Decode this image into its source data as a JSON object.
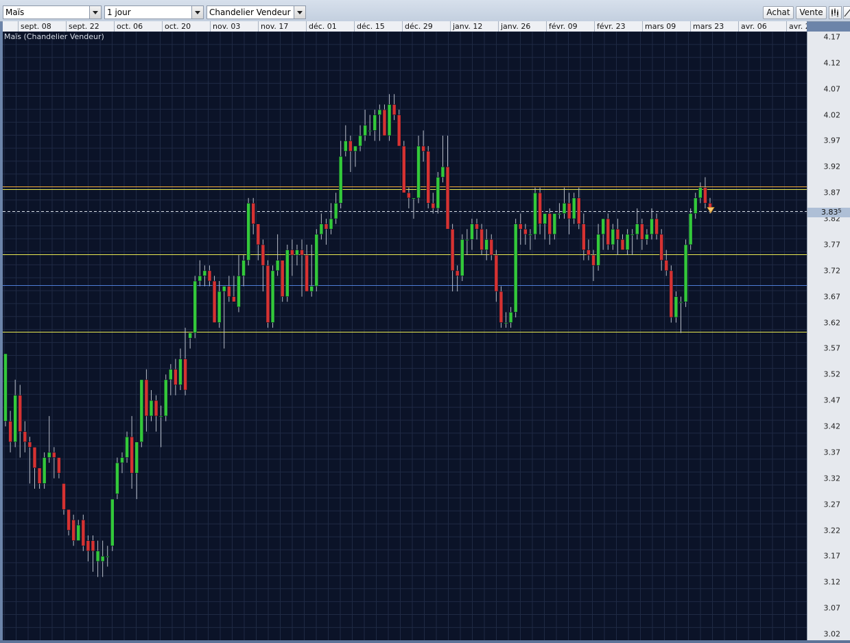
{
  "toolbar": {
    "instrument": "Maïs",
    "timeframe": "1 jour",
    "indicator": "Chandelier Vendeur",
    "buy_label": "Achat",
    "sell_label": "Vente",
    "icons": [
      "candles-icon",
      "draw-line-icon"
    ]
  },
  "colors": {
    "background": "#0b1328",
    "grid": "#1f2a44",
    "up": "#33c93a",
    "down": "#d63232",
    "orange_line": "#f0a838",
    "yellow_line": "#ecec52",
    "blue_line": "#4f7fd8",
    "price_line": "#dfe5ee"
  },
  "chart_data": {
    "type": "candlestick",
    "title": "Maïs (Chandelier Vendeur)",
    "x_labels": [
      "sept. 08",
      "sept. 22",
      "oct. 06",
      "oct. 20",
      "nov. 03",
      "nov. 17",
      "déc. 01",
      "déc. 15",
      "déc. 29",
      "janv. 12",
      "janv. 26",
      "févr. 09",
      "févr. 23",
      "mars 09",
      "mars 23",
      "avr. 06",
      "avr. 2"
    ],
    "ylim": [
      3.02,
      4.17
    ],
    "y_ticks": [
      4.17,
      4.12,
      4.07,
      4.02,
      3.97,
      3.92,
      3.87,
      3.82,
      3.77,
      3.72,
      3.67,
      3.62,
      3.57,
      3.52,
      3.47,
      3.42,
      3.37,
      3.32,
      3.27,
      3.22,
      3.17,
      3.12,
      3.07,
      3.02
    ],
    "current_price": "3.83",
    "current_price_suffix": "5",
    "current_price_value": 3.835,
    "horizontal_lines": [
      {
        "price": 3.882,
        "color": "#f0a838"
      },
      {
        "price": 3.877,
        "color": "#ecec52"
      },
      {
        "price": 3.752,
        "color": "#ecec52"
      },
      {
        "price": 3.692,
        "color": "#4f7fd8"
      },
      {
        "price": 3.602,
        "color": "#ecec52"
      }
    ],
    "candles": [
      {
        "o": 3.43,
        "h": 3.56,
        "l": 3.42,
        "c": 3.56
      },
      {
        "o": 3.43,
        "h": 3.45,
        "l": 3.37,
        "c": 3.39
      },
      {
        "o": 3.39,
        "h": 3.51,
        "l": 3.38,
        "c": 3.48
      },
      {
        "o": 3.48,
        "h": 3.5,
        "l": 3.36,
        "c": 3.41
      },
      {
        "o": 3.41,
        "h": 3.43,
        "l": 3.37,
        "c": 3.39
      },
      {
        "o": 3.39,
        "h": 3.4,
        "l": 3.31,
        "c": 3.38
      },
      {
        "o": 3.38,
        "h": 3.38,
        "l": 3.3,
        "c": 3.34
      },
      {
        "o": 3.34,
        "h": 3.33,
        "l": 3.3,
        "c": 3.31
      },
      {
        "o": 3.31,
        "h": 3.37,
        "l": 3.3,
        "c": 3.36
      },
      {
        "o": 3.36,
        "h": 3.44,
        "l": 3.35,
        "c": 3.37
      },
      {
        "o": 3.37,
        "h": 3.38,
        "l": 3.32,
        "c": 3.36
      },
      {
        "o": 3.36,
        "h": 3.36,
        "l": 3.32,
        "c": 3.33
      },
      {
        "o": 3.31,
        "h": 3.31,
        "l": 3.25,
        "c": 3.26
      },
      {
        "o": 3.26,
        "h": 3.26,
        "l": 3.21,
        "c": 3.22
      },
      {
        "o": 3.24,
        "h": 3.25,
        "l": 3.19,
        "c": 3.2
      },
      {
        "o": 3.2,
        "h": 3.24,
        "l": 3.2,
        "c": 3.23
      },
      {
        "o": 3.24,
        "h": 3.25,
        "l": 3.18,
        "c": 3.19
      },
      {
        "o": 3.2,
        "h": 3.21,
        "l": 3.16,
        "c": 3.18
      },
      {
        "o": 3.2,
        "h": 3.21,
        "l": 3.14,
        "c": 3.18
      },
      {
        "o": 3.16,
        "h": 3.2,
        "l": 3.13,
        "c": 3.18
      },
      {
        "o": 3.16,
        "h": 3.2,
        "l": 3.13,
        "c": 3.17
      },
      {
        "o": 3.17,
        "h": 3.19,
        "l": 3.15,
        "c": 3.17
      },
      {
        "o": 3.19,
        "h": 3.28,
        "l": 3.18,
        "c": 3.28
      },
      {
        "o": 3.29,
        "h": 3.36,
        "l": 3.28,
        "c": 3.35
      },
      {
        "o": 3.35,
        "h": 3.37,
        "l": 3.33,
        "c": 3.36
      },
      {
        "o": 3.36,
        "h": 3.41,
        "l": 3.35,
        "c": 3.4
      },
      {
        "o": 3.4,
        "h": 3.44,
        "l": 3.3,
        "c": 3.33
      },
      {
        "o": 3.33,
        "h": 3.39,
        "l": 3.28,
        "c": 3.39
      },
      {
        "o": 3.39,
        "h": 3.51,
        "l": 3.38,
        "c": 3.51
      },
      {
        "o": 3.51,
        "h": 3.53,
        "l": 3.41,
        "c": 3.44
      },
      {
        "o": 3.44,
        "h": 3.49,
        "l": 3.43,
        "c": 3.47
      },
      {
        "o": 3.47,
        "h": 3.48,
        "l": 3.41,
        "c": 3.44
      },
      {
        "o": 3.44,
        "h": 3.46,
        "l": 3.38,
        "c": 3.44
      },
      {
        "o": 3.44,
        "h": 3.52,
        "l": 3.43,
        "c": 3.51
      },
      {
        "o": 3.51,
        "h": 3.54,
        "l": 3.48,
        "c": 3.53
      },
      {
        "o": 3.53,
        "h": 3.55,
        "l": 3.48,
        "c": 3.5
      },
      {
        "o": 3.5,
        "h": 3.57,
        "l": 3.49,
        "c": 3.55
      },
      {
        "o": 3.55,
        "h": 3.61,
        "l": 3.48,
        "c": 3.49
      },
      {
        "o": 3.59,
        "h": 3.6,
        "l": 3.57,
        "c": 3.6
      },
      {
        "o": 3.6,
        "h": 3.71,
        "l": 3.59,
        "c": 3.7
      },
      {
        "o": 3.7,
        "h": 3.74,
        "l": 3.69,
        "c": 3.71
      },
      {
        "o": 3.71,
        "h": 3.73,
        "l": 3.69,
        "c": 3.72
      },
      {
        "o": 3.72,
        "h": 3.73,
        "l": 3.69,
        "c": 3.7
      },
      {
        "o": 3.7,
        "h": 3.71,
        "l": 3.62,
        "c": 3.62
      },
      {
        "o": 3.62,
        "h": 3.7,
        "l": 3.61,
        "c": 3.68
      },
      {
        "o": 3.68,
        "h": 3.69,
        "l": 3.57,
        "c": 3.69
      },
      {
        "o": 3.69,
        "h": 3.71,
        "l": 3.66,
        "c": 3.67
      },
      {
        "o": 3.67,
        "h": 3.71,
        "l": 3.66,
        "c": 3.66
      },
      {
        "o": 3.65,
        "h": 3.75,
        "l": 3.64,
        "c": 3.71
      },
      {
        "o": 3.71,
        "h": 3.75,
        "l": 3.69,
        "c": 3.74
      },
      {
        "o": 3.74,
        "h": 3.86,
        "l": 3.73,
        "c": 3.85
      },
      {
        "o": 3.85,
        "h": 3.86,
        "l": 3.79,
        "c": 3.81
      },
      {
        "o": 3.81,
        "h": 3.8,
        "l": 3.74,
        "c": 3.77
      },
      {
        "o": 3.77,
        "h": 3.78,
        "l": 3.68,
        "c": 3.73
      },
      {
        "o": 3.73,
        "h": 3.74,
        "l": 3.61,
        "c": 3.62
      },
      {
        "o": 3.62,
        "h": 3.73,
        "l": 3.61,
        "c": 3.72
      },
      {
        "o": 3.72,
        "h": 3.79,
        "l": 3.71,
        "c": 3.74
      },
      {
        "o": 3.74,
        "h": 3.74,
        "l": 3.66,
        "c": 3.67
      },
      {
        "o": 3.67,
        "h": 3.77,
        "l": 3.66,
        "c": 3.76
      },
      {
        "o": 3.76,
        "h": 3.78,
        "l": 3.71,
        "c": 3.75
      },
      {
        "o": 3.75,
        "h": 3.77,
        "l": 3.73,
        "c": 3.76
      },
      {
        "o": 3.76,
        "h": 3.78,
        "l": 3.67,
        "c": 3.75
      },
      {
        "o": 3.75,
        "h": 3.77,
        "l": 3.68,
        "c": 3.68
      },
      {
        "o": 3.68,
        "h": 3.77,
        "l": 3.67,
        "c": 3.69
      },
      {
        "o": 3.69,
        "h": 3.8,
        "l": 3.68,
        "c": 3.79
      },
      {
        "o": 3.79,
        "h": 3.83,
        "l": 3.78,
        "c": 3.81
      },
      {
        "o": 3.81,
        "h": 3.82,
        "l": 3.77,
        "c": 3.8
      },
      {
        "o": 3.8,
        "h": 3.85,
        "l": 3.79,
        "c": 3.82
      },
      {
        "o": 3.82,
        "h": 3.87,
        "l": 3.81,
        "c": 3.85
      },
      {
        "o": 3.85,
        "h": 3.97,
        "l": 3.84,
        "c": 3.94
      },
      {
        "o": 3.95,
        "h": 4.0,
        "l": 3.94,
        "c": 3.97
      },
      {
        "o": 3.97,
        "h": 3.98,
        "l": 3.91,
        "c": 3.95
      },
      {
        "o": 3.95,
        "h": 3.96,
        "l": 3.92,
        "c": 3.96
      },
      {
        "o": 3.96,
        "h": 4.0,
        "l": 3.95,
        "c": 3.98
      },
      {
        "o": 3.98,
        "h": 4.03,
        "l": 3.97,
        "c": 4.0
      },
      {
        "o": 3.99,
        "h": 4.02,
        "l": 3.98,
        "c": 3.99
      },
      {
        "o": 3.99,
        "h": 4.03,
        "l": 3.97,
        "c": 4.02
      },
      {
        "o": 4.02,
        "h": 4.04,
        "l": 3.97,
        "c": 4.03
      },
      {
        "o": 4.03,
        "h": 4.04,
        "l": 3.98,
        "c": 3.98
      },
      {
        "o": 3.98,
        "h": 4.06,
        "l": 3.97,
        "c": 4.04
      },
      {
        "o": 4.04,
        "h": 4.06,
        "l": 4.01,
        "c": 4.02
      },
      {
        "o": 4.02,
        "h": 4.03,
        "l": 3.96,
        "c": 3.96
      },
      {
        "o": 3.96,
        "h": 3.97,
        "l": 3.87,
        "c": 3.87
      },
      {
        "o": 3.87,
        "h": 3.88,
        "l": 3.84,
        "c": 3.86
      },
      {
        "o": 3.86,
        "h": 3.86,
        "l": 3.82,
        "c": 3.86
      },
      {
        "o": 3.86,
        "h": 3.98,
        "l": 3.85,
        "c": 3.96
      },
      {
        "o": 3.96,
        "h": 3.99,
        "l": 3.93,
        "c": 3.95
      },
      {
        "o": 3.95,
        "h": 3.96,
        "l": 3.84,
        "c": 3.85
      },
      {
        "o": 3.85,
        "h": 3.87,
        "l": 3.83,
        "c": 3.84
      },
      {
        "o": 3.84,
        "h": 3.91,
        "l": 3.83,
        "c": 3.9
      },
      {
        "o": 3.9,
        "h": 3.98,
        "l": 3.89,
        "c": 3.92
      },
      {
        "o": 3.92,
        "h": 3.98,
        "l": 3.8,
        "c": 3.8
      },
      {
        "o": 3.8,
        "h": 3.81,
        "l": 3.68,
        "c": 3.72
      },
      {
        "o": 3.72,
        "h": 3.73,
        "l": 3.68,
        "c": 3.71
      },
      {
        "o": 3.71,
        "h": 3.79,
        "l": 3.7,
        "c": 3.78
      },
      {
        "o": 3.78,
        "h": 3.8,
        "l": 3.75,
        "c": 3.78
      },
      {
        "o": 3.78,
        "h": 3.82,
        "l": 3.76,
        "c": 3.81
      },
      {
        "o": 3.81,
        "h": 3.82,
        "l": 3.78,
        "c": 3.8
      },
      {
        "o": 3.8,
        "h": 3.81,
        "l": 3.75,
        "c": 3.76
      },
      {
        "o": 3.76,
        "h": 3.8,
        "l": 3.74,
        "c": 3.78
      },
      {
        "o": 3.78,
        "h": 3.79,
        "l": 3.74,
        "c": 3.75
      },
      {
        "o": 3.75,
        "h": 3.76,
        "l": 3.66,
        "c": 3.68
      },
      {
        "o": 3.68,
        "h": 3.69,
        "l": 3.61,
        "c": 3.62
      },
      {
        "o": 3.62,
        "h": 3.64,
        "l": 3.61,
        "c": 3.62
      },
      {
        "o": 3.62,
        "h": 3.65,
        "l": 3.61,
        "c": 3.64
      },
      {
        "o": 3.64,
        "h": 3.82,
        "l": 3.63,
        "c": 3.81
      },
      {
        "o": 3.81,
        "h": 3.83,
        "l": 3.77,
        "c": 3.8
      },
      {
        "o": 3.8,
        "h": 3.81,
        "l": 3.77,
        "c": 3.79
      },
      {
        "o": 3.79,
        "h": 3.8,
        "l": 3.76,
        "c": 3.79
      },
      {
        "o": 3.79,
        "h": 3.88,
        "l": 3.78,
        "c": 3.87
      },
      {
        "o": 3.87,
        "h": 3.88,
        "l": 3.79,
        "c": 3.81
      },
      {
        "o": 3.81,
        "h": 3.83,
        "l": 3.78,
        "c": 3.83
      },
      {
        "o": 3.83,
        "h": 3.84,
        "l": 3.77,
        "c": 3.79
      },
      {
        "o": 3.79,
        "h": 3.83,
        "l": 3.78,
        "c": 3.83
      },
      {
        "o": 3.83,
        "h": 3.85,
        "l": 3.82,
        "c": 3.83
      },
      {
        "o": 3.83,
        "h": 3.88,
        "l": 3.82,
        "c": 3.85
      },
      {
        "o": 3.85,
        "h": 3.87,
        "l": 3.79,
        "c": 3.82
      },
      {
        "o": 3.82,
        "h": 3.87,
        "l": 3.81,
        "c": 3.86
      },
      {
        "o": 3.86,
        "h": 3.88,
        "l": 3.8,
        "c": 3.81
      },
      {
        "o": 3.81,
        "h": 3.83,
        "l": 3.74,
        "c": 3.76
      },
      {
        "o": 3.76,
        "h": 3.78,
        "l": 3.74,
        "c": 3.75
      },
      {
        "o": 3.75,
        "h": 3.76,
        "l": 3.7,
        "c": 3.73
      },
      {
        "o": 3.73,
        "h": 3.81,
        "l": 3.72,
        "c": 3.79
      },
      {
        "o": 3.79,
        "h": 3.82,
        "l": 3.76,
        "c": 3.82
      },
      {
        "o": 3.82,
        "h": 3.83,
        "l": 3.76,
        "c": 3.77
      },
      {
        "o": 3.77,
        "h": 3.81,
        "l": 3.76,
        "c": 3.8
      },
      {
        "o": 3.8,
        "h": 3.82,
        "l": 3.75,
        "c": 3.78
      },
      {
        "o": 3.78,
        "h": 3.79,
        "l": 3.76,
        "c": 3.76
      },
      {
        "o": 3.76,
        "h": 3.8,
        "l": 3.75,
        "c": 3.79
      },
      {
        "o": 3.79,
        "h": 3.8,
        "l": 3.75,
        "c": 3.79
      },
      {
        "o": 3.79,
        "h": 3.84,
        "l": 3.78,
        "c": 3.81
      },
      {
        "o": 3.81,
        "h": 3.82,
        "l": 3.76,
        "c": 3.78
      },
      {
        "o": 3.78,
        "h": 3.8,
        "l": 3.77,
        "c": 3.79
      },
      {
        "o": 3.79,
        "h": 3.84,
        "l": 3.78,
        "c": 3.82
      },
      {
        "o": 3.82,
        "h": 3.83,
        "l": 3.78,
        "c": 3.79
      },
      {
        "o": 3.79,
        "h": 3.8,
        "l": 3.72,
        "c": 3.74
      },
      {
        "o": 3.74,
        "h": 3.76,
        "l": 3.71,
        "c": 3.72
      },
      {
        "o": 3.72,
        "h": 3.73,
        "l": 3.62,
        "c": 3.63
      },
      {
        "o": 3.63,
        "h": 3.68,
        "l": 3.62,
        "c": 3.67
      },
      {
        "o": 3.66,
        "h": 3.67,
        "l": 3.6,
        "c": 3.66
      },
      {
        "o": 3.66,
        "h": 3.78,
        "l": 3.65,
        "c": 3.77
      },
      {
        "o": 3.77,
        "h": 3.84,
        "l": 3.76,
        "c": 3.83
      },
      {
        "o": 3.83,
        "h": 3.87,
        "l": 3.82,
        "c": 3.86
      },
      {
        "o": 3.86,
        "h": 3.89,
        "l": 3.85,
        "c": 3.88
      },
      {
        "o": 3.88,
        "h": 3.9,
        "l": 3.84,
        "c": 3.85
      },
      {
        "o": 3.85,
        "h": 3.86,
        "l": 3.83,
        "c": 3.84
      }
    ]
  }
}
